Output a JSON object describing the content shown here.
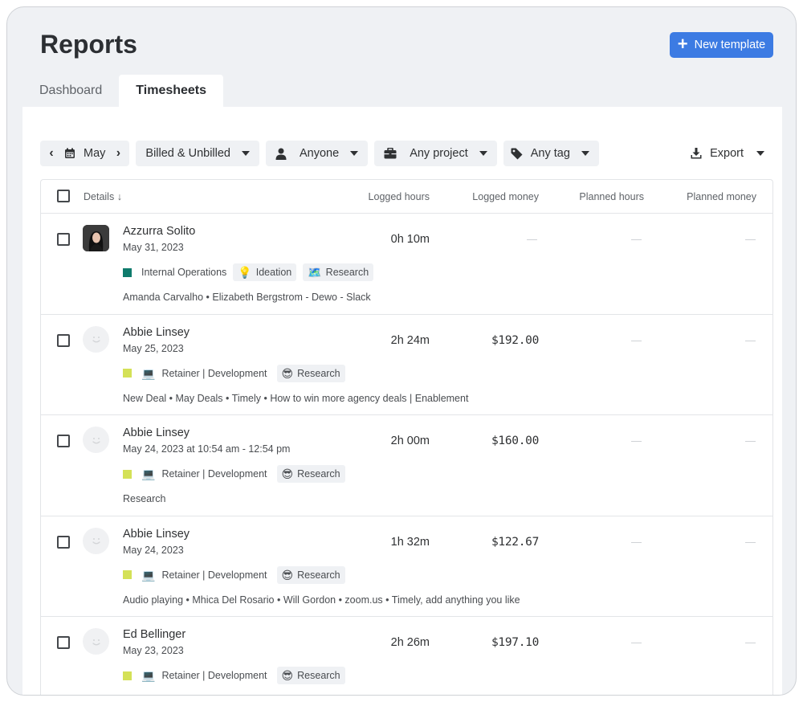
{
  "header": {
    "title": "Reports",
    "new_template_label": "New template"
  },
  "tabs": [
    {
      "label": "Dashboard",
      "active": false
    },
    {
      "label": "Timesheets",
      "active": true
    }
  ],
  "filters": {
    "month": "May",
    "billing": "Billed & Unbilled",
    "person": "Anyone",
    "project": "Any project",
    "tag": "Any tag",
    "export": "Export"
  },
  "table": {
    "columns": [
      "Details",
      "Logged hours",
      "Logged money",
      "Planned hours",
      "Planned money"
    ],
    "sort_indicator": "↓",
    "rows": [
      {
        "name": "Azzurra Solito",
        "date": "May 31, 2023",
        "avatar": "photo",
        "project": {
          "emoji": "",
          "label": "Internal Operations",
          "color": "#0f7b6c"
        },
        "tags": [
          {
            "emoji": "💡",
            "label": "Ideation"
          },
          {
            "emoji": "🗺️",
            "label": "Research"
          }
        ],
        "description": "Amanda Carvalho • Elizabeth Bergstrom - Dewo - Slack",
        "logged_hours": "0h 10m",
        "logged_money": ""
      },
      {
        "name": "Abbie Linsey",
        "date": "May 25, 2023",
        "avatar": "smiley",
        "project": {
          "emoji": "💻",
          "label": "Retainer | Development",
          "color": "#d4e157"
        },
        "tags": [
          {
            "emoji": "😎",
            "label": "Research"
          }
        ],
        "description": "New Deal • May Deals • Timely • How to win more agency deals | Enablement",
        "logged_hours": "2h 24m",
        "logged_money": "$192.00"
      },
      {
        "name": "Abbie Linsey",
        "date": "May 24, 2023 at 10:54 am - 12:54 pm",
        "avatar": "smiley",
        "project": {
          "emoji": "💻",
          "label": "Retainer | Development",
          "color": "#d4e157"
        },
        "tags": [
          {
            "emoji": "😎",
            "label": "Research"
          }
        ],
        "description": "Research",
        "logged_hours": "2h 00m",
        "logged_money": "$160.00"
      },
      {
        "name": "Abbie Linsey",
        "date": "May 24, 2023",
        "avatar": "smiley",
        "project": {
          "emoji": "💻",
          "label": "Retainer | Development",
          "color": "#d4e157"
        },
        "tags": [
          {
            "emoji": "😎",
            "label": "Research"
          }
        ],
        "description": "Audio playing • Mhica Del Rosario • Will Gordon • zoom.us • Timely, add anything you like",
        "logged_hours": "1h 32m",
        "logged_money": "$122.67"
      },
      {
        "name": "Ed Bellinger",
        "date": "May 23, 2023",
        "avatar": "smiley",
        "project": {
          "emoji": "💻",
          "label": "Retainer | Development",
          "color": "#d4e157"
        },
        "tags": [
          {
            "emoji": "😎",
            "label": "Research"
          }
        ],
        "description": "",
        "logged_hours": "2h 26m",
        "logged_money": "$197.10"
      }
    ]
  },
  "colors": {
    "accent": "#3c7be3",
    "background": "#eff1f4"
  }
}
